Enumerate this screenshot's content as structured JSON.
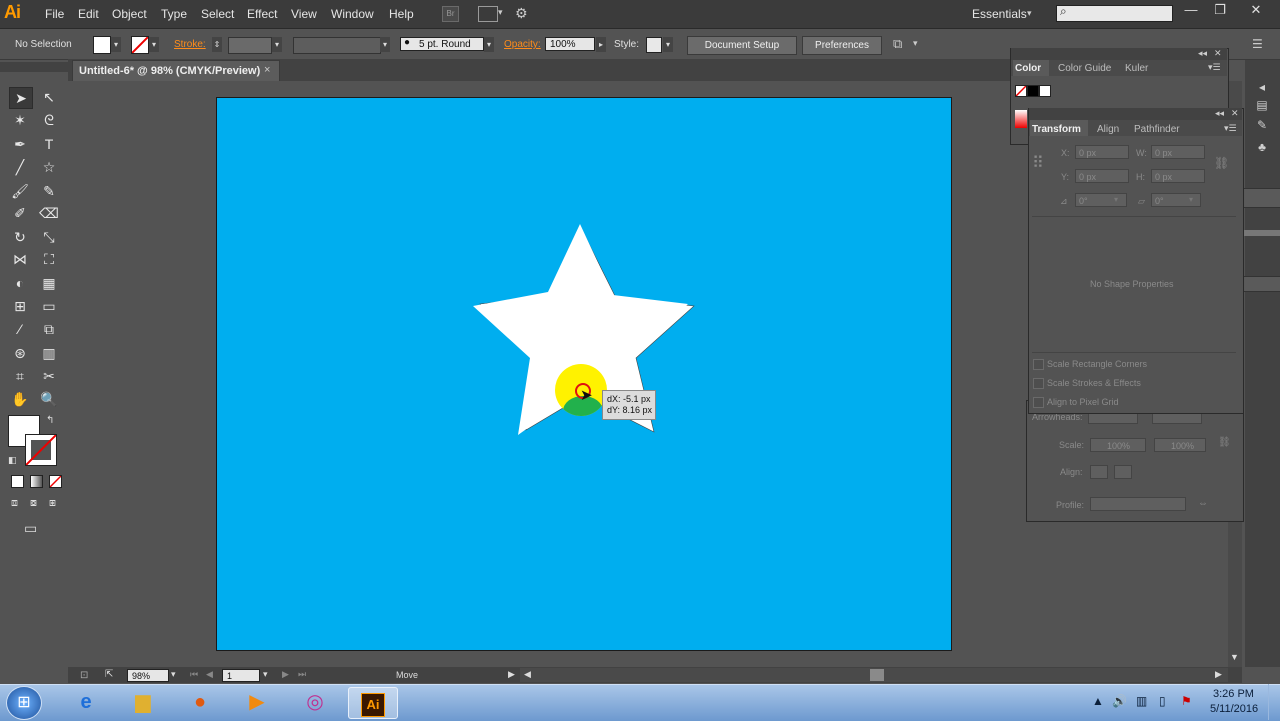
{
  "app": {
    "logo": "Ai"
  },
  "menu": [
    "File",
    "Edit",
    "Object",
    "Type",
    "Select",
    "Effect",
    "View",
    "Window",
    "Help"
  ],
  "menubar": {
    "br_label": "Br",
    "workspace": "Essentials",
    "workspace_arrow": "▾",
    "search_placeholder": ""
  },
  "window_controls": {
    "minimize": "—",
    "restore": "❐",
    "close": "✕"
  },
  "control_bar": {
    "selection": "No Selection",
    "stroke_label": "Stroke:",
    "brush_size": "5 pt. Round",
    "opacity_label": "Opacity:",
    "opacity_value": "100%",
    "style_label": "Style:",
    "document_setup": "Document Setup",
    "preferences": "Preferences"
  },
  "document_tab": {
    "title": "Untitled-6* @ 98% (CMYK/Preview)",
    "close": "×"
  },
  "color_panel": {
    "tabs": [
      "Color",
      "Color Guide",
      "Kuler"
    ]
  },
  "transform_panel": {
    "tabs": [
      "Transform",
      "Align",
      "Pathfinder"
    ],
    "x_label": "X:",
    "x_value": "0 px",
    "y_label": "Y:",
    "y_value": "0 px",
    "w_label": "W:",
    "w_value": "0 px",
    "h_label": "H:",
    "h_value": "0 px",
    "rotate_value": "0°",
    "shear_value": "0°",
    "no_shape": "No Shape Properties",
    "checks": [
      "Scale Rectangle Corners",
      "Scale Strokes & Effects",
      "Align to Pixel Grid"
    ]
  },
  "stroke_panel": {
    "arrowheads_label": "Arrowheads:",
    "scale_label": "Scale:",
    "scale_a": "100%",
    "scale_b": "100%",
    "align_label": "Align:",
    "profile_label": "Profile:"
  },
  "tooltip": {
    "dx": "dX: -5.1 px",
    "dy": "dY: 8.16 px"
  },
  "status_bar": {
    "zoom": "98%",
    "page": "1",
    "tool": "Move"
  },
  "taskbar": {
    "time": "3:26 PM",
    "date": "5/11/2016",
    "ai_label": "Ai"
  },
  "colors": {
    "artboard": "#00aeef",
    "star": "#ffffff",
    "accent": "#ff8c1a",
    "cursor_halo": "#fff200",
    "cursor_click": "#22b14c"
  }
}
